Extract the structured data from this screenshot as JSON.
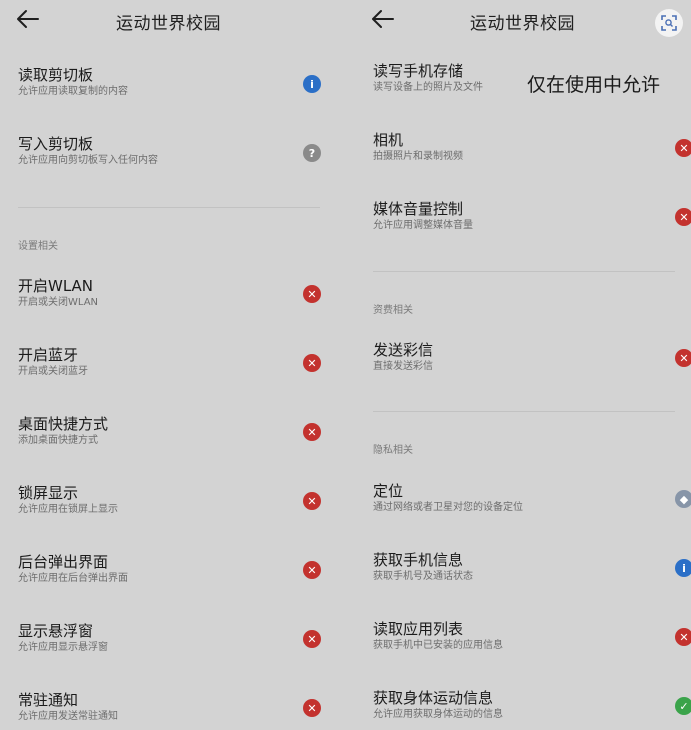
{
  "left": {
    "title": "运动世界校园",
    "items_top": [
      {
        "title": "读取剪切板",
        "desc": "允许应用读取复制的内容",
        "status": "info"
      },
      {
        "title": "写入剪切板",
        "desc": "允许应用向剪切板写入任何内容",
        "status": "ask"
      }
    ],
    "section_label": "设置相关",
    "items": [
      {
        "title": "开启WLAN",
        "desc": "开启或关闭WLAN",
        "status": "deny"
      },
      {
        "title": "开启蓝牙",
        "desc": "开启或关闭蓝牙",
        "status": "deny"
      },
      {
        "title": "桌面快捷方式",
        "desc": "添加桌面快捷方式",
        "status": "deny"
      },
      {
        "title": "锁屏显示",
        "desc": "允许应用在锁屏上显示",
        "status": "deny"
      },
      {
        "title": "后台弹出界面",
        "desc": "允许应用在后台弹出界面",
        "status": "deny"
      },
      {
        "title": "显示悬浮窗",
        "desc": "允许应用显示悬浮窗",
        "status": "deny"
      },
      {
        "title": "常驻通知",
        "desc": "允许应用发送常驻通知",
        "status": "deny"
      }
    ]
  },
  "right": {
    "title": "运动世界校园",
    "overlay_text": "仅在使用中允许",
    "items_top": [
      {
        "title": "读写手机存储",
        "desc": "读写设备上的照片及文件",
        "status": "none"
      },
      {
        "title": "相机",
        "desc": "拍摄照片和录制视频",
        "status": "deny"
      },
      {
        "title": "媒体音量控制",
        "desc": "允许应用调整媒体音量",
        "status": "deny"
      }
    ],
    "section1_label": "资费相关",
    "items_mid": [
      {
        "title": "发送彩信",
        "desc": "直接发送彩信",
        "status": "deny"
      }
    ],
    "section2_label": "隐私相关",
    "items_bottom": [
      {
        "title": "定位",
        "desc": "通过网络或者卫星对您的设备定位",
        "status": "loc"
      },
      {
        "title": "获取手机信息",
        "desc": "获取手机号及通话状态",
        "status": "info"
      },
      {
        "title": "读取应用列表",
        "desc": "获取手机中已安装的应用信息",
        "status": "deny"
      },
      {
        "title": "获取身体运动信息",
        "desc": "允许应用获取身体运动的信息",
        "status": "allow"
      }
    ]
  },
  "status_glyphs": {
    "deny": "✕",
    "ask": "?",
    "info": "ⓘ",
    "allow": "✓",
    "loc": "◈"
  },
  "colors": {
    "deny": "#c3322e",
    "allow": "#3aa34a",
    "info": "#2b6fc7",
    "ask": "#8a8a8a"
  }
}
